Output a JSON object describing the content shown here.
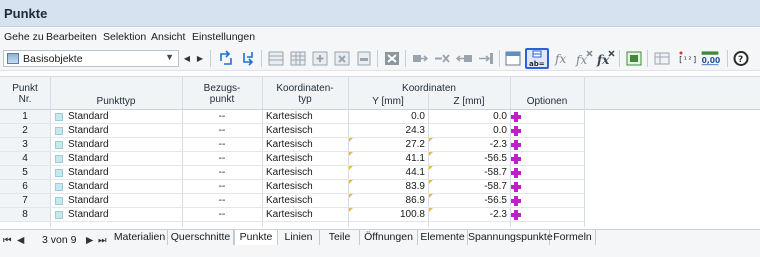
{
  "window": {
    "title": "Punkte"
  },
  "menu": [
    "Gehe zu",
    "Bearbeiten",
    "Selektion",
    "Ansicht",
    "Einstellungen"
  ],
  "toolbar": {
    "combo_value": "Basisobjekte",
    "tool_icons": [
      "select-icon",
      "select-pick-icon",
      "table-icon",
      "table-grid-icon",
      "add-row-icon",
      "delete-row-icon",
      "insert-row-icon",
      "clear-icon",
      "move-right-icon",
      "delete-col-icon",
      "move-left-icon",
      "move-end-icon",
      "split-view-icon",
      "label-ab-icon",
      "fx-icon",
      "fx-clear-icon",
      "fx-bold-icon",
      "export-icon",
      "filter-icon",
      "value-icon",
      "decimals-icon",
      "help-icon"
    ],
    "selected_tool": "label-ab-icon",
    "decimals_label": "0,00"
  },
  "table": {
    "headers": {
      "nr_line1": "Punkt",
      "nr_line2": "Nr.",
      "type": "Punkttyp",
      "ref_line1": "Bezugs-",
      "ref_line2": "punkt",
      "coord_line1": "Koordinaten-",
      "coord_line2": "typ",
      "coords_group": "Koordinaten",
      "y": "Y [mm]",
      "z": "Z [mm]",
      "options": "Optionen"
    },
    "rows": [
      {
        "nr": "1",
        "type": "Standard",
        "ref": "--",
        "coord": "Kartesisch",
        "y": "0.0",
        "z": "0.0"
      },
      {
        "nr": "2",
        "type": "Standard",
        "ref": "--",
        "coord": "Kartesisch",
        "y": "24.3",
        "z": "0.0"
      },
      {
        "nr": "3",
        "type": "Standard",
        "ref": "--",
        "coord": "Kartesisch",
        "y": "27.2",
        "z": "-2.3"
      },
      {
        "nr": "4",
        "type": "Standard",
        "ref": "--",
        "coord": "Kartesisch",
        "y": "41.1",
        "z": "-56.5"
      },
      {
        "nr": "5",
        "type": "Standard",
        "ref": "--",
        "coord": "Kartesisch",
        "y": "44.1",
        "z": "-58.7"
      },
      {
        "nr": "6",
        "type": "Standard",
        "ref": "--",
        "coord": "Kartesisch",
        "y": "83.9",
        "z": "-58.7"
      },
      {
        "nr": "7",
        "type": "Standard",
        "ref": "--",
        "coord": "Kartesisch",
        "y": "86.9",
        "z": "-56.5"
      },
      {
        "nr": "8",
        "type": "Standard",
        "ref": "--",
        "coord": "Kartesisch",
        "y": "100.8",
        "z": "-2.3"
      }
    ]
  },
  "pager": {
    "text": "3 von 9"
  },
  "tabs": [
    "Materialien",
    "Querschnitte",
    "Punkte",
    "Linien",
    "Teile",
    "Öffnungen",
    "Elemente",
    "Spannungspunkte",
    "Formeln"
  ],
  "active_tab": "Punkte"
}
